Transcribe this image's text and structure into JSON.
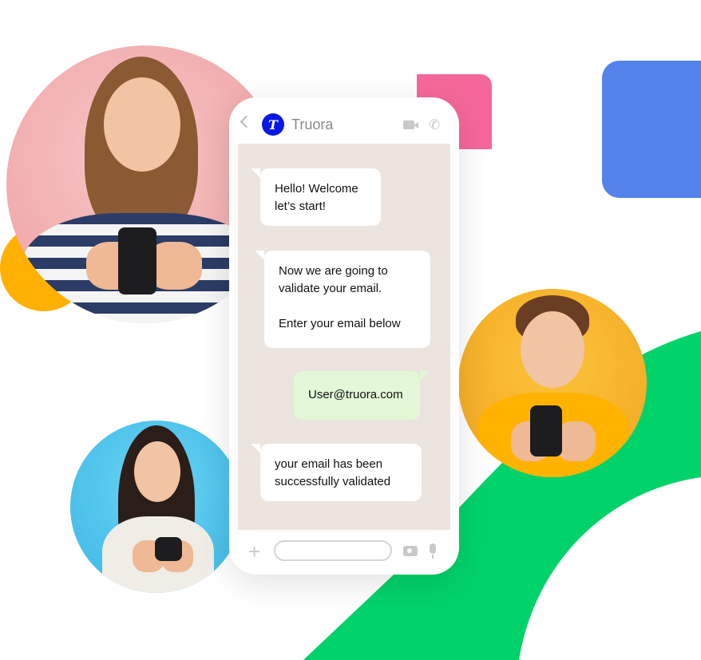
{
  "header": {
    "brand_name": "Truora",
    "brand_logo_letter": "T",
    "icons": [
      "back-chevron-icon",
      "truora-logo-icon",
      "video-camera-icon",
      "phone-call-icon"
    ]
  },
  "chat": {
    "messages": [
      {
        "direction": "incoming",
        "text": "Hello! Welcome\nlet’s start!"
      },
      {
        "direction": "incoming",
        "text": "Now we are going to\nvalidate your email.\n\nEnter your email below"
      },
      {
        "direction": "outgoing",
        "text": "User@truora.com"
      },
      {
        "direction": "incoming",
        "text": "your email has been\nsuccessfully validated"
      }
    ]
  },
  "footer": {
    "input_value": "",
    "icons": [
      "plus-icon",
      "camera-icon",
      "microphone-icon"
    ]
  },
  "colors": {
    "brand_blue": "#0b17e6",
    "chat_background": "#ece4df",
    "outgoing_bubble": "#e2f8d6",
    "accent_green": "#00d26a",
    "accent_blue": "#5583ec",
    "accent_pink": "#f5679a",
    "accent_yellow": "#ffb000"
  }
}
